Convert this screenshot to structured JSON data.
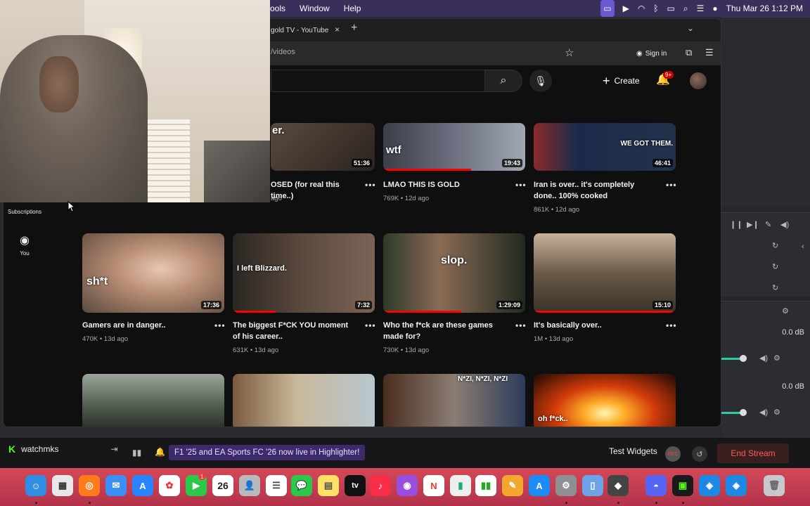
{
  "menubar": {
    "menus": [
      "ools",
      "Window",
      "Help"
    ],
    "datetime": "Thu Mar 26  1:12 PM"
  },
  "browser": {
    "tab_title": "gold TV - YouTube",
    "tab_close": "×",
    "new_tab": "+",
    "url": "/videos",
    "signin_label": "Sign in"
  },
  "youtube": {
    "create_label": "Create",
    "notification_badge": "9+",
    "sidebar": [
      {
        "label": "Subscriptions",
        "icon": "subscriptions-icon"
      },
      {
        "label": "You",
        "icon": "user-circle-icon"
      }
    ],
    "rows": [
      {
        "videos": [
          {
            "title": "OSED (for real this time..)",
            "meta": "ago",
            "duration": "51:36",
            "overlay": "er.",
            "progress": 0
          },
          {
            "title": "LMAO THIS IS GOLD",
            "meta": "769K • 12d ago",
            "duration": "19:43",
            "overlay": "wtf",
            "progress": 0.62
          },
          {
            "title": "Iran is over.. it's completely done.. 100% cooked",
            "meta": "861K • 12d ago",
            "duration": "46:41",
            "overlay": "WE GOT THEM.",
            "progress": 0
          }
        ]
      },
      {
        "videos": [
          {
            "title": "Gamers are in danger..",
            "meta": "470K • 13d ago",
            "duration": "17:36",
            "overlay": "sh*t",
            "progress": 0
          },
          {
            "title": "The biggest F*CK YOU moment of his career..",
            "meta": "631K • 13d ago",
            "duration": "7:32",
            "overlay": "I left Blizzard.",
            "progress": 0.3
          },
          {
            "title": "Who the f*ck are these games made for?",
            "meta": "730K • 13d ago",
            "duration": "1:29:09",
            "overlay": "slop.",
            "progress": 0.55
          },
          {
            "title": "It's basically over..",
            "meta": "1M • 13d ago",
            "duration": "15:10",
            "overlay": "",
            "progress": 0.98
          }
        ]
      },
      {
        "videos": [
          {
            "overlay": ""
          },
          {
            "overlay": ""
          },
          {
            "overlay": "N*ZI, N*ZI, N*ZI"
          },
          {
            "overlay": "oh f*ck.."
          }
        ]
      }
    ],
    "more_label": "•••"
  },
  "stream_app": {
    "db_1": "0.0 dB",
    "db_2": "0.0 dB",
    "channel": "watchmks",
    "channel_icon": "K",
    "banner": "F1 '25 and EA Sports FC '26 now live in Highlighter!",
    "test_widgets": "Test Widgets",
    "rec_label": "REC",
    "end_stream": "End Stream"
  },
  "dock": {
    "calendar_day": "26",
    "tv_label": "tv",
    "mail_badge": "1"
  }
}
